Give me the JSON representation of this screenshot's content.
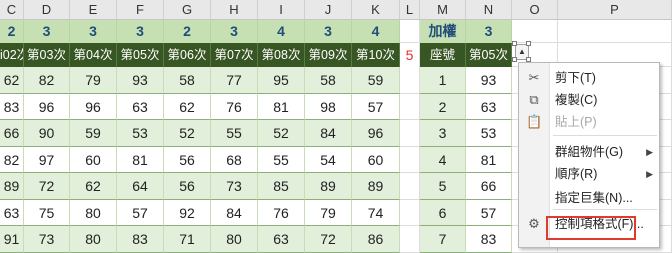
{
  "columns": [
    "C",
    "D",
    "E",
    "F",
    "G",
    "H",
    "I",
    "J",
    "K",
    "L",
    "M",
    "N",
    "O",
    "P"
  ],
  "weights": [
    "2",
    "3",
    "3",
    "3",
    "2",
    "3",
    "4",
    "3",
    "4"
  ],
  "weight_label": "加權",
  "weight_n": "3",
  "headers": [
    "i02次",
    "第03次",
    "第04次",
    "第05次",
    "第06次",
    "第07次",
    "第08次",
    "第09次",
    "第10次"
  ],
  "l_value": "5",
  "seat_header": "座號",
  "n_header": "第05次",
  "rows": [
    [
      "62",
      "82",
      "79",
      "93",
      "58",
      "77",
      "95",
      "58",
      "59"
    ],
    [
      "83",
      "96",
      "96",
      "63",
      "62",
      "76",
      "81",
      "98",
      "57"
    ],
    [
      "66",
      "90",
      "59",
      "53",
      "52",
      "55",
      "52",
      "84",
      "96"
    ],
    [
      "82",
      "97",
      "60",
      "81",
      "56",
      "68",
      "55",
      "54",
      "60"
    ],
    [
      "89",
      "72",
      "62",
      "64",
      "56",
      "73",
      "85",
      "89",
      "89"
    ],
    [
      "63",
      "75",
      "80",
      "57",
      "92",
      "84",
      "76",
      "79",
      "74"
    ],
    [
      "91",
      "73",
      "80",
      "83",
      "71",
      "80",
      "63",
      "72",
      "86"
    ]
  ],
  "seat_numbers": [
    "1",
    "2",
    "3",
    "4",
    "5",
    "6",
    "7"
  ],
  "n_values": [
    "93",
    "63",
    "53",
    "81",
    "66",
    "57",
    "83"
  ],
  "menu": {
    "items": [
      {
        "label": "剪下(T)",
        "icon": "scissors-icon",
        "glyph": "✂",
        "disabled": false,
        "submenu": false
      },
      {
        "label": "複製(C)",
        "icon": "copy-icon",
        "glyph": "⧉",
        "disabled": false,
        "submenu": false
      },
      {
        "label": "貼上(P)",
        "icon": "paste-icon",
        "glyph": "📋",
        "disabled": true,
        "submenu": false
      },
      {
        "label": "群組物件(G)",
        "icon": "",
        "glyph": "",
        "disabled": false,
        "submenu": true
      },
      {
        "label": "順序(R)",
        "icon": "",
        "glyph": "",
        "disabled": false,
        "submenu": true
      },
      {
        "label": "指定巨集(N)...",
        "icon": "",
        "glyph": "",
        "disabled": false,
        "submenu": false
      },
      {
        "label": "控制項格式(F)...",
        "icon": "format-control-icon",
        "glyph": "⚙",
        "disabled": false,
        "submenu": false
      }
    ],
    "highlight_color": "#e03a2e"
  },
  "colors": {
    "header_dark_green": "#375623",
    "weight_light_green": "#c6e0b4",
    "band_green": "#e2efda",
    "weight_text_blue": "#1f4e79",
    "red_value": "#e0312b"
  }
}
